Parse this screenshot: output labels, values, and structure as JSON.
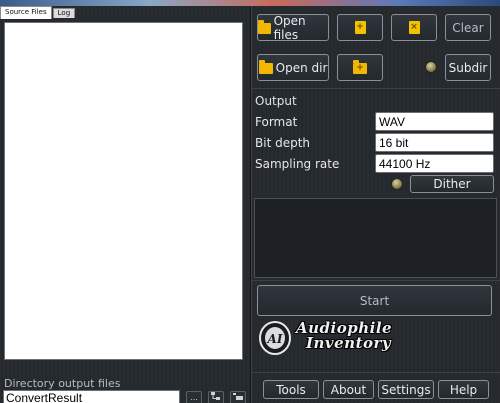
{
  "tabs": [
    {
      "label": "Source Files",
      "active": true
    },
    {
      "label": "Log",
      "active": false
    }
  ],
  "left": {
    "dir_label": "Directory output files",
    "dir_value": "ConvertResult",
    "browse_label": "..."
  },
  "file_buttons": {
    "open_files": "Open files",
    "clear": "Clear",
    "open_dir": "Open dir",
    "subdir": "Subdir"
  },
  "output": {
    "title": "Output",
    "rows": [
      {
        "label": "Format",
        "value": "WAV"
      },
      {
        "label": "Bit depth",
        "value": "16 bit"
      },
      {
        "label": "Sampling rate",
        "value": "44100 Hz"
      }
    ],
    "dither_label": "Dither"
  },
  "start_label": "Start",
  "logo": {
    "line1": "Audiophile",
    "line2": "Inventory",
    "badge": "AI"
  },
  "bottom_menu": [
    "Tools",
    "About",
    "Settings",
    "Help"
  ],
  "colors": {
    "background": "#24292e",
    "folder_icon": "#f0b800",
    "led": "#b8ae7a",
    "top_strip": "#8aa8c8"
  },
  "icons": {
    "add_file": "add-file-icon",
    "remove_file": "remove-file-icon",
    "add_folder": "add-folder-icon",
    "folder": "folder-icon"
  }
}
